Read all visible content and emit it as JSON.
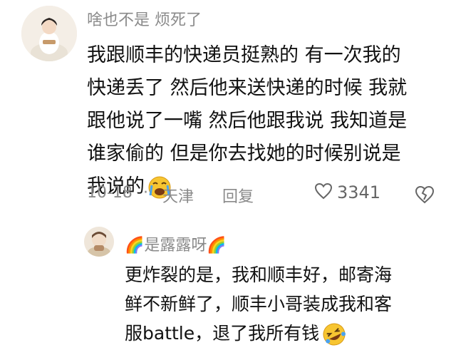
{
  "comment1": {
    "username": "啥也不是 烦死了",
    "lines": [
      "我跟顺丰的快递员挺熟的 有一次我的",
      "快递丢了 然后他来送快递的时候 我就",
      "跟他说了一嘴 然后他跟我说 我知道是",
      "谁家偷的 但是你去找她的时候别说是",
      "我说的"
    ],
    "emoji_icon": "crying-face-icon",
    "date": "10-18",
    "separator": "·",
    "location": "天津",
    "reply_label": "回复",
    "like_count": "3341"
  },
  "comment2": {
    "username": "🌈是露露呀🌈",
    "lines": [
      "更炸裂的是，我和顺丰好，邮寄海",
      "鲜不新鲜了，顺丰小哥装成我和客",
      "服battle，退了我所有钱"
    ],
    "emoji_icon": "rolling-laughing-face-icon"
  },
  "colors": {
    "meta_text": "#8a8a8a",
    "body_text": "#111111",
    "emoji_yellow": "#f7c531"
  }
}
